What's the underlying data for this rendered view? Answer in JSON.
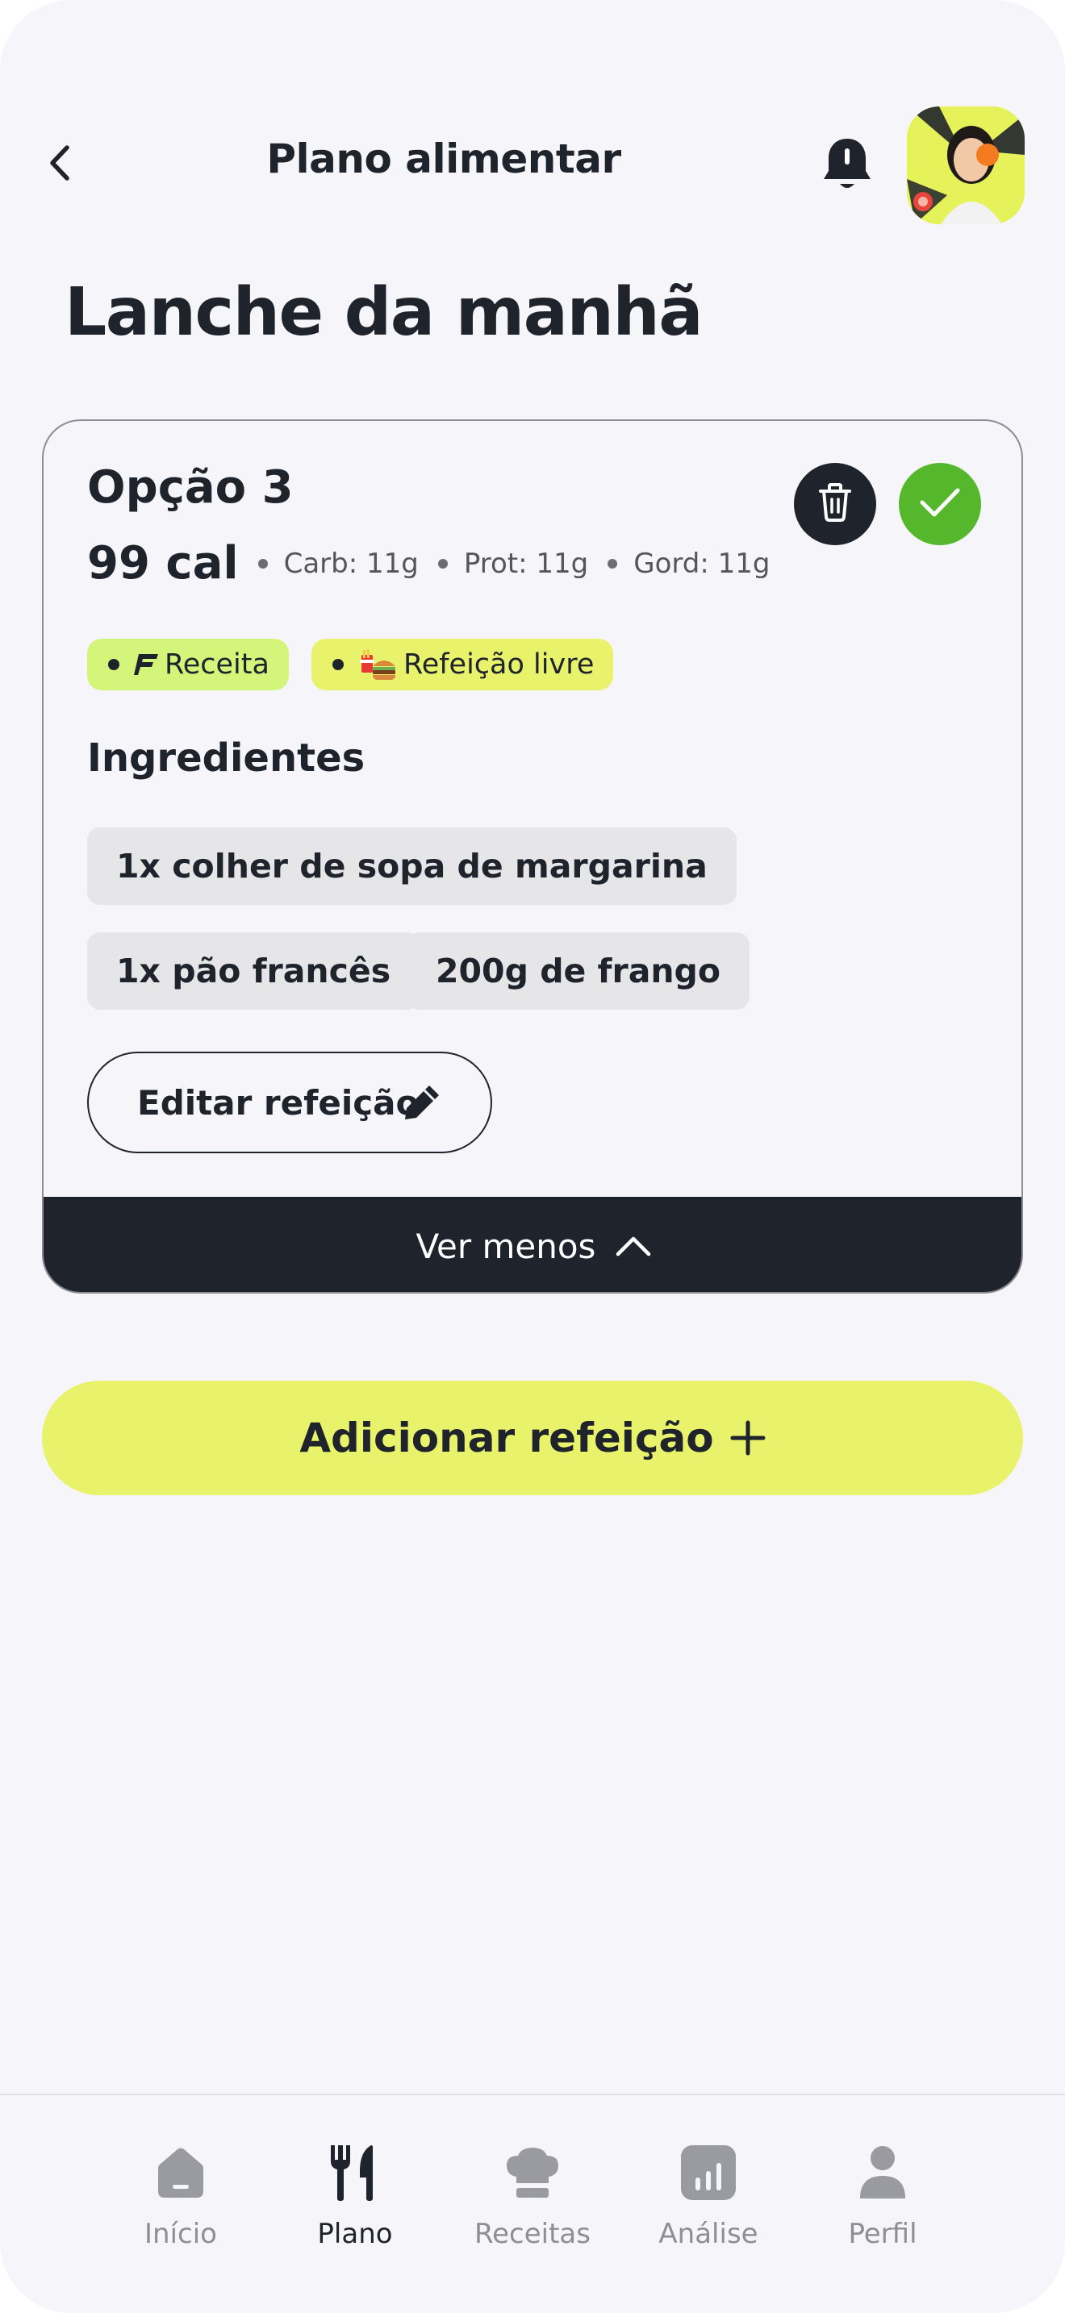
{
  "header": {
    "title": "Plano alimentar",
    "back_icon": "chevron-left-icon",
    "notification_icon": "bell-icon",
    "avatar_alt": "user-avatar"
  },
  "page": {
    "title": "Lanche da manhã"
  },
  "meal": {
    "option_title": "Opção 3",
    "calories": "99 cal",
    "macros": [
      "Carb: 11g",
      "Prot: 11g",
      "Gord: 11g"
    ],
    "tags": [
      {
        "label": "Receita",
        "icon": "brand-logo-icon",
        "color": "#d3f57a"
      },
      {
        "label": "Refeição livre",
        "icon": "fast-food-emoji-icon",
        "color": "#e8f26a"
      }
    ],
    "ingredients_title": "Ingredientes",
    "ingredients": [
      "1x colher de sopa de margarina",
      "1x pão francês",
      "200g de frango"
    ],
    "edit_label": "Editar refeição",
    "collapse_label": "Ver menos",
    "delete_icon": "trash-icon",
    "confirm_icon": "check-icon",
    "confirm_color": "#55b72b"
  },
  "actions": {
    "add_meal_label": "Adicionar refeição",
    "accent_color": "#e8f26a"
  },
  "tabbar": {
    "items": [
      {
        "label": "Início",
        "icon": "home-icon",
        "active": false
      },
      {
        "label": "Plano",
        "icon": "utensils-icon",
        "active": true
      },
      {
        "label": "Receitas",
        "icon": "chef-hat-icon",
        "active": false
      },
      {
        "label": "Análise",
        "icon": "bar-chart-icon",
        "active": false
      },
      {
        "label": "Perfil",
        "icon": "user-icon",
        "active": false
      }
    ]
  }
}
